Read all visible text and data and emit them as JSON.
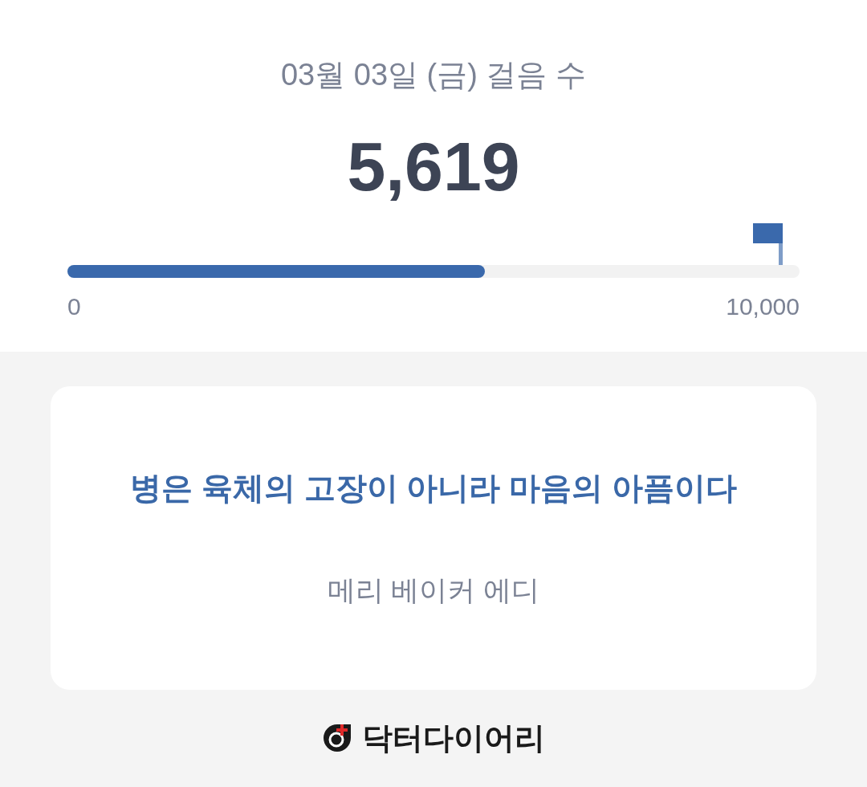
{
  "steps": {
    "title": "03월 03일 (금) 걸음 수",
    "count": "5,619",
    "progress": {
      "level": 0.57,
      "min_label": "0",
      "max_label": "10,000"
    }
  },
  "quote": {
    "text": "병은 육체의 고장이 아니라 마음의 아픔이다",
    "author": "메리 베이커 에디"
  },
  "footer": {
    "brand": "닥터다이어리"
  }
}
